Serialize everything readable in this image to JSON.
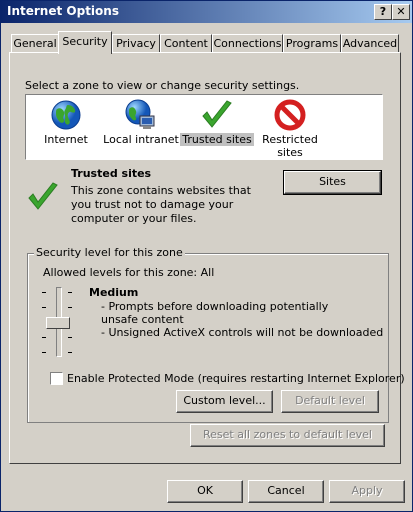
{
  "window": {
    "title": "Internet Options",
    "help_label": "?",
    "close_label": "✕"
  },
  "tabs": [
    {
      "label": "General"
    },
    {
      "label": "Security"
    },
    {
      "label": "Privacy"
    },
    {
      "label": "Content"
    },
    {
      "label": "Connections"
    },
    {
      "label": "Programs"
    },
    {
      "label": "Advanced"
    }
  ],
  "zones": {
    "prompt": "Select a zone to view or change security settings.",
    "items": [
      {
        "label": "Internet",
        "icon": "globe-icon"
      },
      {
        "label": "Local intranet",
        "icon": "intranet-icon"
      },
      {
        "label": "Trusted sites",
        "icon": "checkmark-icon"
      },
      {
        "label": "Restricted sites",
        "icon": "restricted-icon"
      }
    ]
  },
  "zone_info": {
    "title": "Trusted sites",
    "description": "This zone contains websites that you trust not to damage your computer or your files.",
    "sites_button": "Sites"
  },
  "security_level": {
    "group_title": "Security level for this zone",
    "allowed": "Allowed levels for this zone: All",
    "level_name": "Medium",
    "bullet1": "- Prompts before downloading potentially unsafe content",
    "bullet2": "- Unsigned ActiveX controls will not be downloaded",
    "protected_mode": "Enable Protected Mode (requires restarting Internet Explorer)",
    "custom_button": "Custom level...",
    "default_button": "Default level",
    "reset_button": "Reset all zones to default level"
  },
  "footer": {
    "ok": "OK",
    "cancel": "Cancel",
    "apply": "Apply"
  },
  "colors": {
    "titlebar": "#0a246a",
    "face": "#d4d0c8",
    "green": "#3aa52e",
    "red": "#d42020"
  }
}
